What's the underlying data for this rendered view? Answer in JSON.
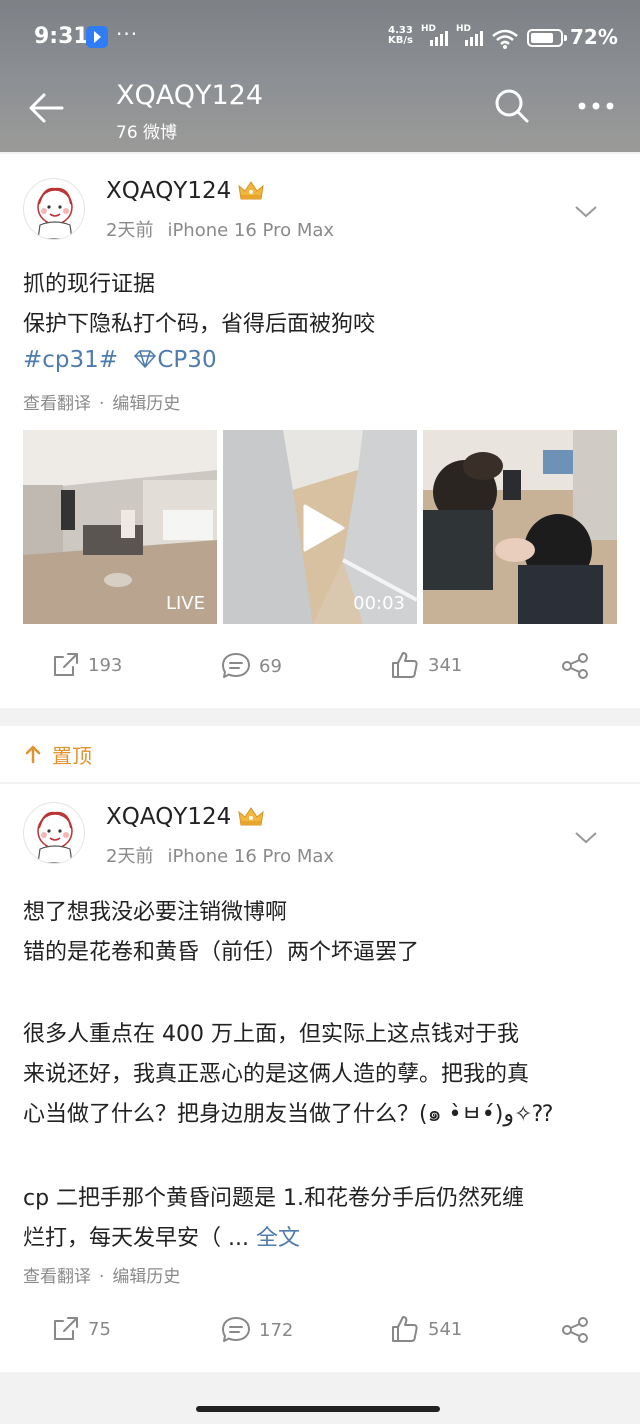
{
  "status_bar": {
    "time": "9:31",
    "dots": "···",
    "speed_top": "4.33",
    "speed_bottom": "KB/s",
    "hd1": "HD",
    "hd2": "HD",
    "battery": "72%"
  },
  "nav": {
    "title": "XQAQY124",
    "subtitle": "76 微博",
    "icons": [
      "back-arrow-icon",
      "search-icon",
      "more-icon"
    ]
  },
  "posts": [
    {
      "username": "XQAQY124",
      "time": "2天前",
      "device": "iPhone 16 Pro Max",
      "lines": [
        "抓的现行证据",
        "保护下隐私打个码，省得后面被狗咬"
      ],
      "tags": [
        "#cp31#",
        "CP30"
      ],
      "translate": "查看翻译",
      "separator": "·",
      "edit_history": "编辑历史",
      "media": [
        {
          "type": "photo",
          "badge": "LIVE"
        },
        {
          "type": "video",
          "badge": "00:03"
        },
        {
          "type": "photo",
          "badge": ""
        }
      ],
      "repost": "193",
      "comments": "69",
      "likes": "341"
    },
    {
      "username": "XQAQY124",
      "time": "2天前",
      "device": "iPhone 16 Pro Max",
      "lines": [
        "想了想我没必要注销微博啊",
        "错的是花卷和黄昏（前任）两个坏逼罢了",
        "",
        "很多人重点在 400 万上面，但实际上这点钱对于我",
        "来说还好，我真正恶心的是这俩人造的孽。把我的真",
        "心当做了什么？把身边朋友当做了什么？(๑ •̀ㅂ•́)و✧⁇",
        "",
        "cp 二把手那个黄昏问题是 1.和花卷分手后仍然死缠",
        "烂打，每天发早安（ ..."
      ],
      "full_text": "全文",
      "translate": "查看翻译",
      "separator": "·",
      "edit_history": "编辑历史",
      "repost": "75",
      "comments": "172",
      "likes": "541"
    }
  ],
  "pinned": {
    "label": "置顶"
  },
  "colors": {
    "link": "#4f7cae",
    "pinned": "#e0932f",
    "meta": "#8a8a8a"
  }
}
